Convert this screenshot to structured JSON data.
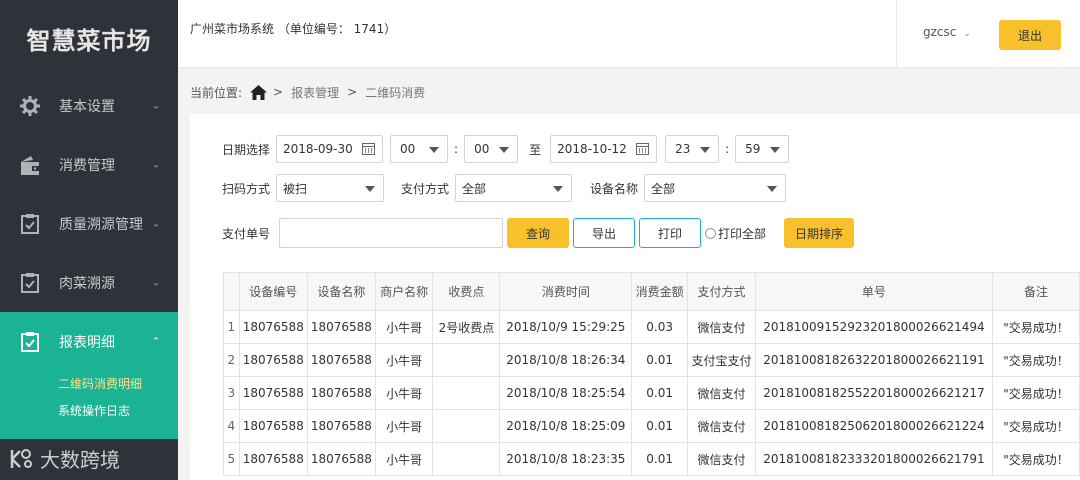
{
  "sidebar": {
    "logo": "智慧菜市场",
    "items": [
      {
        "label": "基本设置",
        "icon": "gear-icon"
      },
      {
        "label": "消费管理",
        "icon": "wallet-icon"
      },
      {
        "label": "质量溯源管理",
        "icon": "clipboard-icon"
      },
      {
        "label": "肉菜溯源",
        "icon": "clipboard-icon"
      },
      {
        "label": "报表明细",
        "icon": "clipboard-icon"
      }
    ],
    "subitems": [
      "二维码消费明细",
      "系统操作日志"
    ],
    "watermark": "大数跨境"
  },
  "topbar": {
    "system_title": "广州菜市场系统 （单位编号： 1741）",
    "username": "gzcsc",
    "logout_label": "退出"
  },
  "breadcrumb": {
    "prefix": "当前位置:",
    "items": [
      "报表管理",
      "二维码消费"
    ],
    "separator": ">"
  },
  "filters": {
    "date_label": "日期选择",
    "start_date": "2018-09-30",
    "start_hour": "00",
    "start_minute": "00",
    "to_label": "至",
    "end_date": "2018-10-12",
    "end_hour": "23",
    "end_minute": "59",
    "scan_label": "扫码方式",
    "scan_value": "被扫",
    "pay_method_label": "支付方式",
    "pay_method_value": "全部",
    "device_label": "设备名称",
    "device_value": "全部",
    "pay_no_label": "支付单号",
    "pay_no_value": "",
    "query_label": "查询",
    "export_label": "导出",
    "print_label": "打印",
    "print_all_label": "打印全部",
    "date_sort_label": "日期排序"
  },
  "table": {
    "headers": [
      "",
      "设备编号",
      "设备名称",
      "商户名称",
      "收费点",
      "消费时间",
      "消费金额",
      "支付方式",
      "单号",
      "备注"
    ],
    "rows": [
      [
        "1",
        "18076588",
        "18076588",
        "小牛哥",
        "2号收费点",
        "2018/10/9 15:29:25",
        "0.03",
        "微信支付",
        "20181009152923201800026621494",
        "\"交易成功！"
      ],
      [
        "2",
        "18076588",
        "18076588",
        "小牛哥",
        "",
        "2018/10/8 18:26:34",
        "0.01",
        "支付宝支付",
        "20181008182632201800026621191",
        "\"交易成功！"
      ],
      [
        "3",
        "18076588",
        "18076588",
        "小牛哥",
        "",
        "2018/10/8 18:25:54",
        "0.01",
        "微信支付",
        "20181008182552201800026621217",
        "\"交易成功！"
      ],
      [
        "4",
        "18076588",
        "18076588",
        "小牛哥",
        "",
        "2018/10/8 18:25:09",
        "0.01",
        "微信支付",
        "20181008182506201800026621224",
        "\"交易成功！"
      ],
      [
        "5",
        "18076588",
        "18076588",
        "小牛哥",
        "",
        "2018/10/8 18:23:35",
        "0.01",
        "微信支付",
        "20181008182333201800026621791",
        "\"交易成功！"
      ]
    ]
  }
}
